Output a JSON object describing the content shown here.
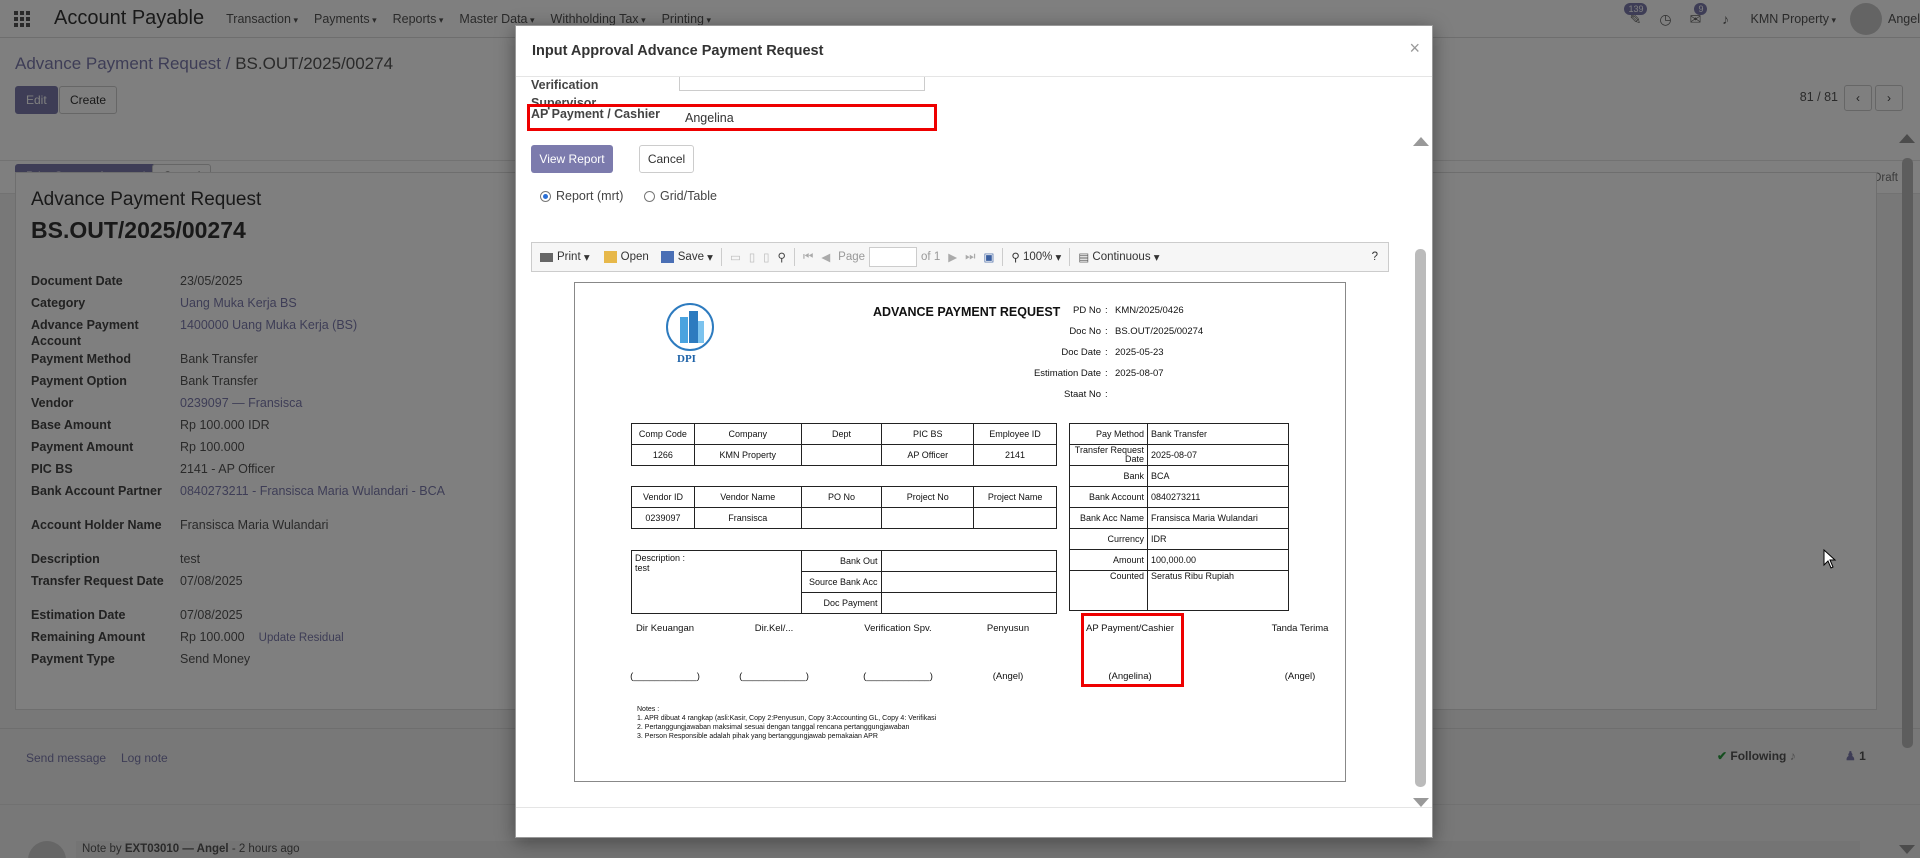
{
  "navbar": {
    "app_title": "Account Payable",
    "menus": [
      "Transaction",
      "Payments",
      "Reports",
      "Master Data",
      "Withholding Tax",
      "Printing"
    ],
    "badges": {
      "activity": "139",
      "messages": "9"
    },
    "company": "KMN Property",
    "user": "Angel"
  },
  "control": {
    "breadcrumb_parent": "Advance Payment Request",
    "breadcrumb_sep": "/",
    "breadcrumb_current": "BS.OUT/2025/00274",
    "edit_label": "Edit",
    "create_label": "Create",
    "pager": "81 / 81",
    "print_custom_label": "Print Custom Approval",
    "cancel_label": "Cancel",
    "stages": [
      "Request",
      "Draft"
    ]
  },
  "form": {
    "title": "Advance Payment Request",
    "reference": "BS.OUT/2025/00274",
    "fields": [
      {
        "label": "Document Date",
        "value": "23/05/2025",
        "link": false
      },
      {
        "label": "Category",
        "value": "Uang Muka Kerja BS",
        "link": true
      },
      {
        "label": "Advance Payment Account",
        "value": "1400000 Uang Muka Kerja (BS)",
        "link": true
      },
      {
        "label": "Payment Method",
        "value": "Bank Transfer",
        "link": false
      },
      {
        "label": "Payment Option",
        "value": "Bank Transfer",
        "link": false
      },
      {
        "label": "Vendor",
        "value": "0239097 — Fransisca",
        "link": true
      },
      {
        "label": "Base Amount",
        "value": "Rp 100.000 IDR",
        "link": false
      },
      {
        "label": "Payment Amount",
        "value": "Rp 100.000",
        "link": false
      },
      {
        "label": "PIC BS",
        "value": "2141 - AP Officer",
        "link": false
      },
      {
        "label": "Bank Account Partner",
        "value": "0840273211 - Fransisca Maria Wulandari - BCA",
        "link": true
      },
      {
        "label": "Account Holder Name",
        "value": "Fransisca Maria Wulandari",
        "link": false
      },
      {
        "label": "Description",
        "value": "test",
        "link": false
      },
      {
        "label": "Transfer Request Date",
        "value": "07/08/2025",
        "link": false
      },
      {
        "label": "Estimation Date",
        "value": "07/08/2025",
        "link": false
      },
      {
        "label": "Remaining Amount",
        "value": "Rp 100.000",
        "link": false
      },
      {
        "label": "Payment Type",
        "value": "Send Money",
        "link": false
      }
    ],
    "update_residual": "Update Residual"
  },
  "chatter": {
    "send_message": "Send message",
    "log_note": "Log note",
    "following": "Following",
    "followers": "1",
    "note_prefix": "Note by",
    "note_author": "EXT03010 — Angel",
    "note_time": "- 2 hours ago"
  },
  "modal": {
    "title": "Input Approval Advance Payment Request",
    "verification_label": "Verification Supervisor",
    "verification_value": "",
    "cashier_label": "AP Payment / Cashier",
    "cashier_value": "Angelina",
    "view_report_label": "View Report",
    "cancel_label": "Cancel",
    "radio_report": "Report (mrt)",
    "radio_grid": "Grid/Table",
    "toolbar": {
      "print": "Print",
      "open": "Open",
      "save": "Save",
      "page_label": "Page",
      "page_of": "of 1",
      "zoom": "100%",
      "view_mode": "Continuous",
      "help": "?"
    }
  },
  "report": {
    "logo_text": "DPI",
    "title": "ADVANCE PAYMENT REQUEST",
    "header": [
      {
        "label": "PD No",
        "value": "KMN/2025/0426"
      },
      {
        "label": "Doc No",
        "value": "BS.OUT/2025/00274"
      },
      {
        "label": "Doc Date",
        "value": "2025-05-23"
      },
      {
        "label": "Estimation Date",
        "value": "2025-08-07"
      },
      {
        "label": "Staat No",
        "value": ""
      }
    ],
    "t1_headers": [
      "Comp Code",
      "Company",
      "Dept",
      "PIC BS",
      "Employee ID"
    ],
    "t1_values": [
      "1266",
      "KMN Property",
      "",
      "AP Officer",
      "2141"
    ],
    "t2_headers": [
      "Vendor ID",
      "Vendor Name",
      "PO No",
      "Project No",
      "Project Name"
    ],
    "t2_values": [
      "0239097",
      "Fransisca",
      "",
      "",
      ""
    ],
    "description_label": "Description :",
    "description_value": "test",
    "bank_rows": [
      "Bank Out",
      "Source Bank Acc",
      "Doc Payment"
    ],
    "pay_rows": [
      {
        "label": "Pay Method",
        "value": "Bank Transfer"
      },
      {
        "label": "Transfer Request Date",
        "value": "2025-08-07"
      },
      {
        "label": "Bank",
        "value": "BCA"
      },
      {
        "label": "Bank Account",
        "value": "0840273211"
      },
      {
        "label": "Bank Acc Name",
        "value": "Fransisca Maria Wulandari"
      },
      {
        "label": "Currency",
        "value": "IDR"
      },
      {
        "label": "Amount",
        "value": "100,000.00"
      },
      {
        "label": "Counted",
        "value": "Seratus Ribu Rupiah"
      }
    ],
    "signatures": [
      {
        "role": "Dir Keuangan",
        "name": "(____________)"
      },
      {
        "role": "Dir.Kel/...",
        "name": "(____________)"
      },
      {
        "role": "Verification Spv.",
        "name": "(____________)"
      },
      {
        "role": "Penyusun",
        "name": "(Angel)"
      },
      {
        "role": "AP Payment/Cashier",
        "name": "(Angelina)"
      },
      {
        "role": "Tanda Terima",
        "name": "(Angel)"
      }
    ],
    "notes_title": "Notes :",
    "notes": [
      "1. APR dibuat 4 rangkap (asli:Kasir, Copy 2:Penyusun, Copy 3:Accounting GL, Copy 4: Verifikasi",
      "2. Pertanggungjawaban maksimal sesuai dengan tanggal rencana pertanggungjawaban",
      "3. Person Responsible adalah pihak yang bertanggungjawab pemakaian APR"
    ]
  },
  "colors": {
    "primary": "#7c7bad",
    "highlight": "#e00000"
  }
}
